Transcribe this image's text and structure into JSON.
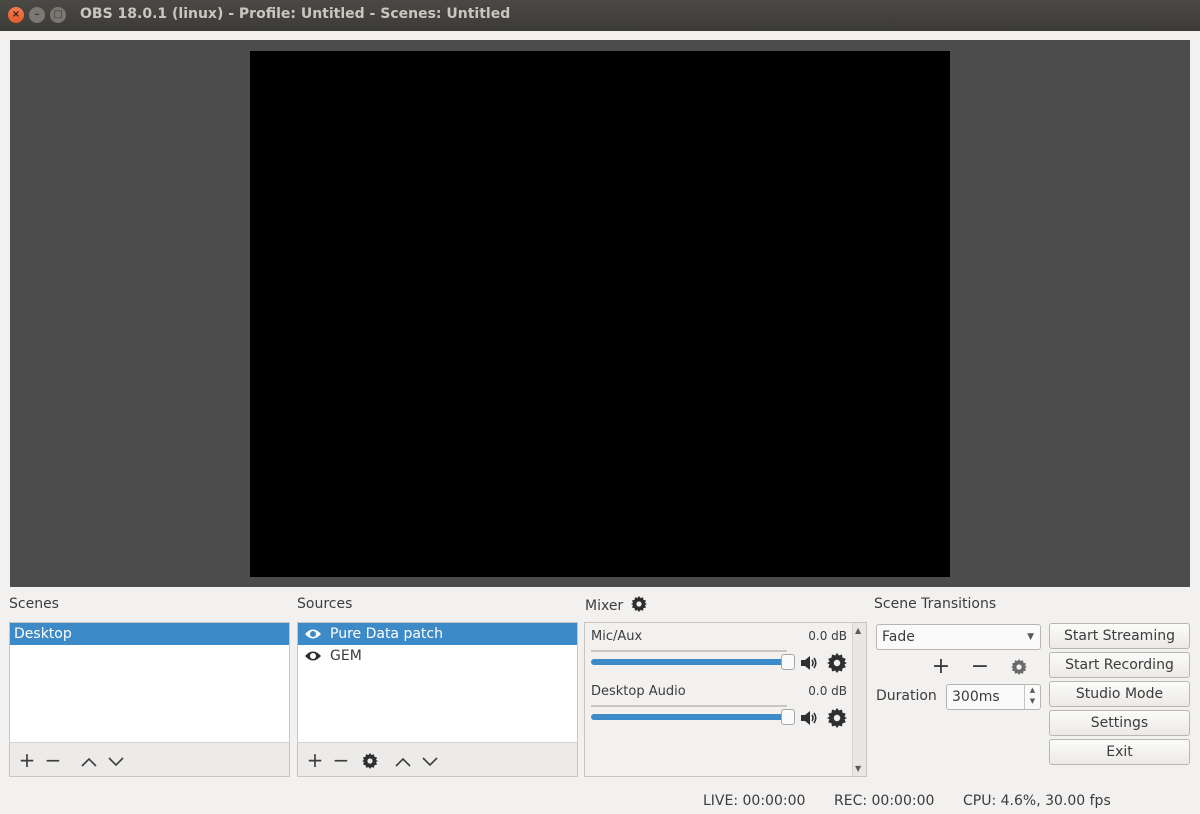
{
  "window": {
    "title": "OBS 18.0.1 (linux) - Profile: Untitled - Scenes: Untitled"
  },
  "docks": {
    "scenes_label": "Scenes",
    "sources_label": "Sources",
    "mixer_label": "Mixer",
    "transitions_label": "Scene Transitions"
  },
  "scenes": {
    "items": [
      {
        "label": "Desktop",
        "selected": true
      }
    ]
  },
  "sources": {
    "items": [
      {
        "label": "Pure Data patch",
        "selected": true,
        "icon": "eye-icon"
      },
      {
        "label": "GEM",
        "selected": false,
        "icon": "eye-icon"
      }
    ]
  },
  "mixer": {
    "channels": [
      {
        "name": "Mic/Aux",
        "level": "0.0 dB",
        "volume_fraction": 1.0
      },
      {
        "name": "Desktop Audio",
        "level": "0.0 dB",
        "volume_fraction": 1.0
      }
    ]
  },
  "transitions": {
    "selected": "Fade",
    "duration_label": "Duration",
    "duration_value": "300ms"
  },
  "controls": {
    "start_streaming": "Start Streaming",
    "start_recording": "Start Recording",
    "studio_mode": "Studio Mode",
    "settings": "Settings",
    "exit": "Exit"
  },
  "status": {
    "live": "LIVE: 00:00:00",
    "rec": "REC: 00:00:00",
    "cpu": "CPU: 4.6%, 30.00 fps"
  },
  "colors": {
    "selection": "#3c8ac7",
    "preview_bg": "#4c4c4c",
    "canvas": "#000000"
  }
}
